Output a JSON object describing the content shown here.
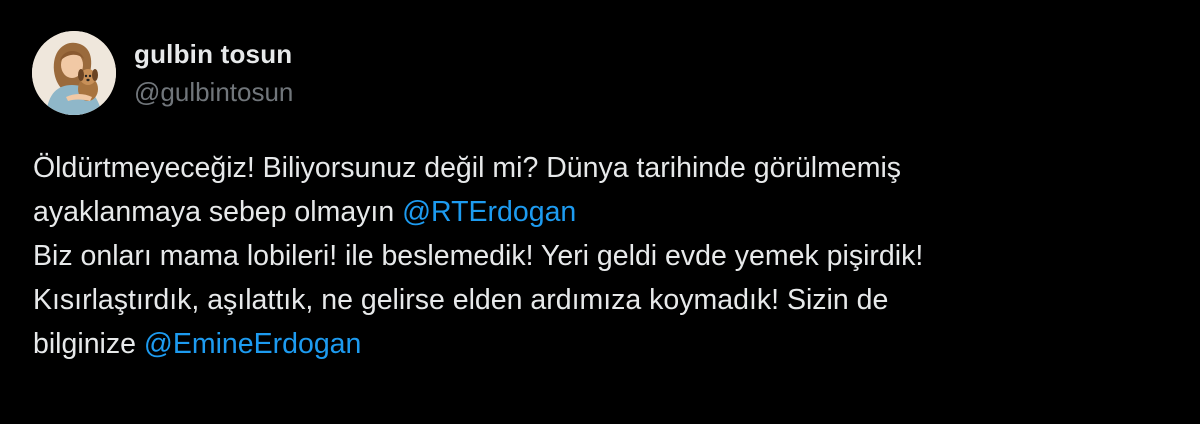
{
  "author": {
    "display_name": "gulbin tosun",
    "handle": "@gulbintosun"
  },
  "tweet": {
    "line1": "Öldürtmeyeceğiz! Biliyorsunuz değil mi? Dünya tarihinde görülmemiş",
    "line2_text": "ayaklanmaya sebep olmayın ",
    "line2_mention": "@RTErdogan",
    "line3": "Biz onları mama lobileri! ile beslemedik! Yeri geldi evde yemek pişirdik!",
    "line4": "Kısırlaştırdık, aşılattık, ne gelirse elden ardımıza koymadık! Sizin de",
    "line5_text": "bilginize ",
    "line5_mention": "@EmineErdogan"
  },
  "colors": {
    "background": "#000000",
    "text": "#e7e9ea",
    "secondary": "#71767b",
    "mention": "#1d9bf0"
  }
}
